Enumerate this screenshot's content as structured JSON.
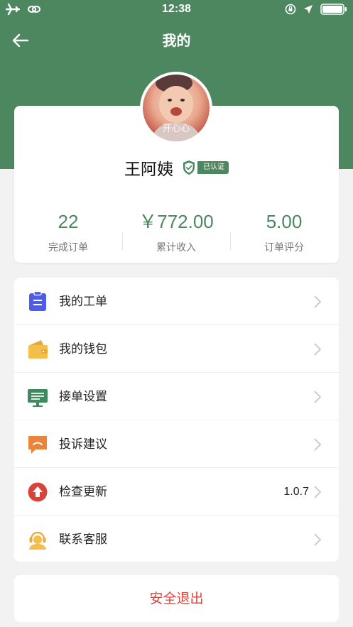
{
  "status_bar": {
    "time": "12:38"
  },
  "nav": {
    "title": "我的"
  },
  "profile": {
    "avatar_caption": "开心心",
    "name": "王阿姨",
    "verified_label": "已认证"
  },
  "stats": [
    {
      "value": "22",
      "label": "完成订单"
    },
    {
      "value": "￥772.00",
      "label": "累计收入"
    },
    {
      "value": "5.00",
      "label": "订单评分"
    }
  ],
  "menu": [
    {
      "label": "我的工单",
      "icon": "clipboard-icon",
      "color": "#4f5ce8"
    },
    {
      "label": "我的钱包",
      "icon": "wallet-icon",
      "color": "#f2bf4a"
    },
    {
      "label": "接单设置",
      "icon": "monitor-icon",
      "color": "#3d8a5f"
    },
    {
      "label": "投诉建议",
      "icon": "feedback-icon",
      "color": "#e8853b"
    },
    {
      "label": "检查更新",
      "icon": "update-icon",
      "color": "#d8433a",
      "value": "1.0.7"
    },
    {
      "label": "联系客服",
      "icon": "support-icon",
      "color": "#f2bf4a"
    }
  ],
  "logout_label": "安全退出",
  "colors": {
    "primary": "#4c8760",
    "danger": "#e0423b"
  }
}
